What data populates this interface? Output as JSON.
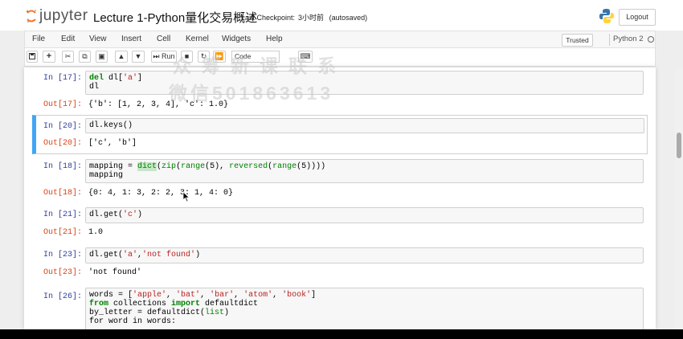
{
  "header": {
    "logo_text": "jupyter",
    "notebook_title": "Lecture 1-Python量化交易概述",
    "checkpoint_label": "Last Checkpoint:",
    "checkpoint_time": "3小时前",
    "autosave": "(autosaved)",
    "logout_label": "Logout"
  },
  "menu": [
    "File",
    "Edit",
    "View",
    "Insert",
    "Cell",
    "Kernel",
    "Widgets",
    "Help"
  ],
  "status": {
    "trusted": "Trusted",
    "kernel": "Python 2"
  },
  "toolbar": {
    "run_label": "Run",
    "cell_type": "Code"
  },
  "watermark": {
    "line1": "众筹新课联系",
    "line2": "微信501863613"
  },
  "cells": {
    "c17": {
      "in_prompt": "In [17]:",
      "line1_kw": "del",
      "line1_rest": " dl[",
      "line1_str": "'a'",
      "line1_end": "]",
      "line2": "dl",
      "out_prompt": "Out[17]:",
      "output": "{'b': [1, 2, 3, 4], 'c': 1.0}"
    },
    "c20": {
      "in_prompt": "In [20]:",
      "code": "dl.keys()",
      "out_prompt": "Out[20]:",
      "output": "['c', 'b']"
    },
    "c18": {
      "in_prompt": "In [18]:",
      "p1": "mapping = ",
      "dict": "dict",
      "p2": "(",
      "zip": "zip",
      "p3": "(",
      "range1": "range",
      "p4": "(5), ",
      "reversed": "reversed",
      "p5": "(",
      "range2": "range",
      "p6": "(5))))",
      "line2": "mapping",
      "out_prompt": "Out[18]:",
      "output": "{0: 4, 1: 3, 2: 2, 3: 1, 4: 0}"
    },
    "c21": {
      "in_prompt": "In [21]:",
      "p1": "dl.get(",
      "str": "'c'",
      "p2": ")",
      "out_prompt": "Out[21]:",
      "output": "1.0"
    },
    "c23": {
      "in_prompt": "In [23]:",
      "p1": "dl.get(",
      "s1": "'a'",
      "p2": ",",
      "s2": "'not found'",
      "p3": ")",
      "out_prompt": "Out[23]:",
      "output": "'not found'"
    },
    "c26": {
      "in_prompt": "In [26]:",
      "l1_a": "words = [",
      "l1_s1": "'apple'",
      "l1_c1": ", ",
      "l1_s2": "'bat'",
      "l1_c2": ", ",
      "l1_s3": "'bar'",
      "l1_c3": ", ",
      "l1_s4": "'atom'",
      "l1_c4": ", ",
      "l1_s5": "'book'",
      "l1_e": "]",
      "l2_kw1": "from",
      "l2_mid": " collections ",
      "l2_kw2": "import",
      "l2_end": " defaultdict",
      "l3_a": "by_letter = defaultdict(",
      "l3_bi": "list",
      "l3_e": ")",
      "l4": "for word in words:"
    }
  }
}
